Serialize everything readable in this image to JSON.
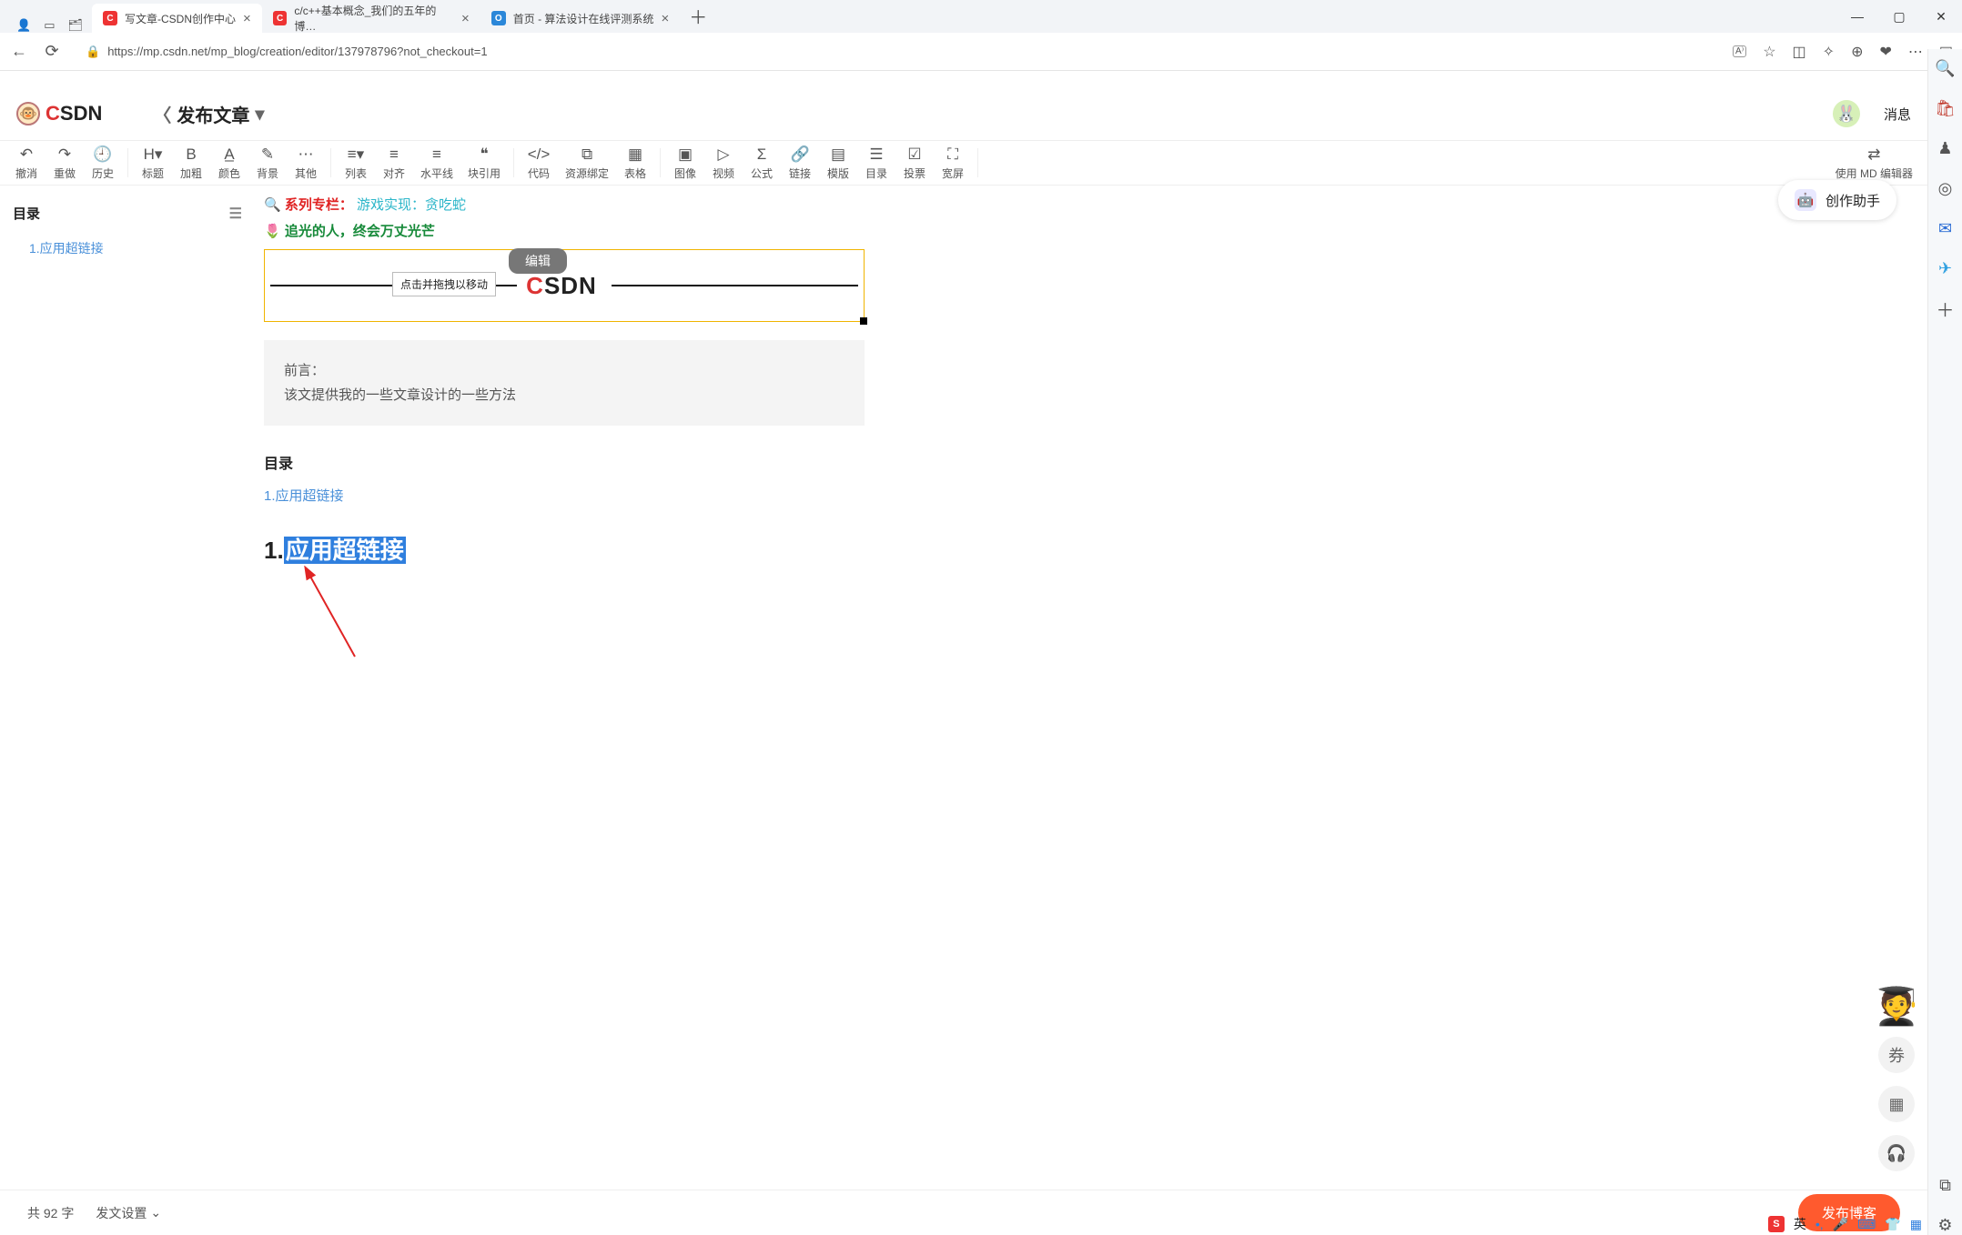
{
  "browser": {
    "tabs": [
      {
        "favicon": "C",
        "title": "写文章-CSDN创作中心",
        "active": true
      },
      {
        "favicon": "C",
        "title": "c/c++基本概念_我们的五年的博…",
        "active": false
      },
      {
        "favicon": "O",
        "title": "首页 - 算法设计在线评测系统",
        "active": false,
        "blue": true
      }
    ],
    "url": "https://mp.csdn.net/mp_blog/creation/editor/137978796?not_checkout=1"
  },
  "header": {
    "logo": "CSDN",
    "page_title": "发布文章",
    "messages": "消息"
  },
  "toolbar": {
    "groups": [
      [
        {
          "ic": "↶",
          "lb": "撤消"
        },
        {
          "ic": "↷",
          "lb": "重做"
        },
        {
          "ic": "🕘",
          "lb": "历史"
        }
      ],
      [
        {
          "ic": "H▾",
          "lb": "标题"
        },
        {
          "ic": "B",
          "lb": "加粗"
        },
        {
          "ic": "A̲",
          "lb": "颜色"
        },
        {
          "ic": "✎",
          "lb": "背景"
        },
        {
          "ic": "⋯",
          "lb": "其他"
        }
      ],
      [
        {
          "ic": "≡▾",
          "lb": "列表"
        },
        {
          "ic": "≡",
          "lb": "对齐"
        },
        {
          "ic": "≡",
          "lb": "水平线"
        },
        {
          "ic": "❝",
          "lb": "块引用"
        }
      ],
      [
        {
          "ic": "</>",
          "lb": "代码"
        },
        {
          "ic": "⧉",
          "lb": "资源绑定"
        },
        {
          "ic": "▦",
          "lb": "表格"
        }
      ],
      [
        {
          "ic": "▣",
          "lb": "图像"
        },
        {
          "ic": "▷",
          "lb": "视频"
        },
        {
          "ic": "Σ",
          "lb": "公式"
        },
        {
          "ic": "🔗",
          "lb": "链接"
        },
        {
          "ic": "▤",
          "lb": "模版"
        },
        {
          "ic": "☰",
          "lb": "目录"
        },
        {
          "ic": "☑",
          "lb": "投票"
        },
        {
          "ic": "⛶",
          "lb": "宽屏"
        }
      ]
    ],
    "md_switch": "使用 MD 编辑器"
  },
  "sidebar": {
    "title": "目录",
    "items": [
      "1.应用超链接"
    ]
  },
  "content": {
    "series_label": "系列专栏：",
    "series_rest": "游戏实现：贪吃蛇",
    "motto": "追光的人，终会万丈光芒",
    "drag_tip": "点击并拖拽以移动",
    "edit_badge": "编辑",
    "img_text": "CSDN",
    "quote_line1": "前言：",
    "quote_line2": "该文提供我的一些文章设计的一些方法",
    "toc_title": "目录",
    "toc_link": "1.应用超链接",
    "h1_num": "1.",
    "h1_sel": "应用超链接"
  },
  "assistant": {
    "label": "创作助手"
  },
  "footer": {
    "wordcount": "共 92 字",
    "settings": "发文设置",
    "publish": "发布博客"
  },
  "ime": {
    "lang": "英"
  }
}
